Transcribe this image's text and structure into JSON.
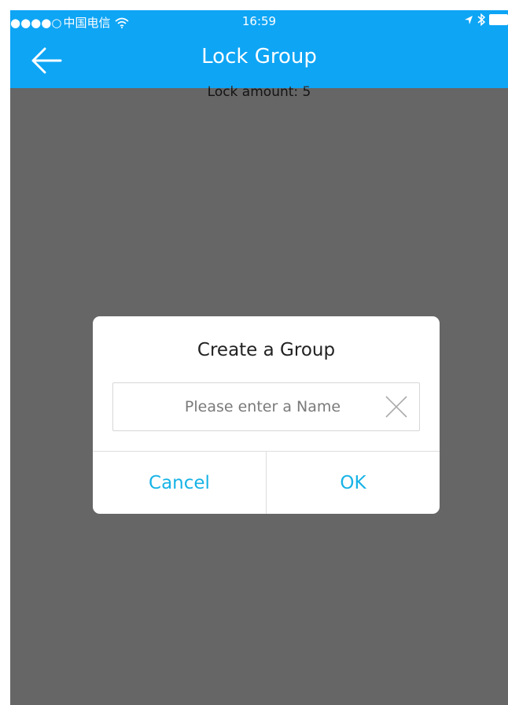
{
  "status_bar": {
    "signal": "●●●●○",
    "carrier": "中国电信",
    "wifi_icon": "wifi-icon",
    "time": "16:59",
    "location_icon": "location-arrow-icon",
    "bluetooth_icon": "bluetooth-icon",
    "battery_icon": "battery-icon"
  },
  "nav": {
    "back_icon": "back-arrow-icon",
    "title": "Lock Group"
  },
  "content": {
    "lock_amount": "Lock amount: 5"
  },
  "dialog": {
    "title": "Create a Group",
    "name_input": {
      "value": "",
      "placeholder": "Please enter a Name"
    },
    "clear_icon": "clear-icon",
    "cancel_label": "Cancel",
    "ok_label": "OK"
  },
  "colors": {
    "header": "#0ea5f5",
    "button_text": "#17b3e6",
    "overlay": "rgba(0,0,0,0.6)"
  }
}
